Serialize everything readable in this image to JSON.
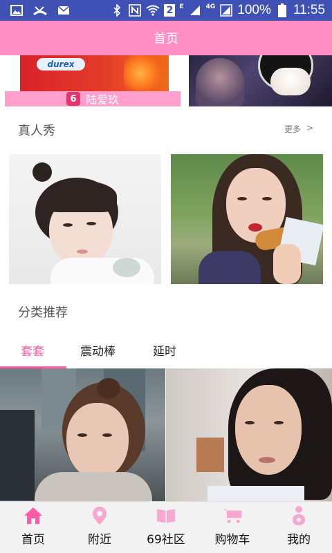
{
  "status_bar": {
    "network_badge": "2",
    "network_type_e": "E",
    "network_type_4g": "4G",
    "battery": "100%",
    "time": "11:55"
  },
  "app_bar": {
    "title": "首页"
  },
  "banner": {
    "durex_logo": "durex",
    "brand_mark": "6",
    "brand_name": "陆爱玖"
  },
  "sections": {
    "real_show": {
      "title": "真人秀",
      "more": "更多",
      "more_arrow": ">"
    },
    "category": {
      "title": "分类推荐"
    }
  },
  "tabs": [
    {
      "label": "套套",
      "active": true
    },
    {
      "label": "震动棒",
      "active": false
    },
    {
      "label": "延时",
      "active": false
    }
  ],
  "bottom_nav": [
    {
      "label": "首页",
      "icon": "home-icon",
      "active": true
    },
    {
      "label": "附近",
      "icon": "location-pin-icon",
      "active": false
    },
    {
      "label": "69社区",
      "icon": "book-icon",
      "active": false
    },
    {
      "label": "购物车",
      "icon": "cart-icon",
      "active": false
    },
    {
      "label": "我的",
      "icon": "user-icon",
      "active": false
    }
  ],
  "colors": {
    "status_bar": "#3f51b5",
    "app_bar": "#ff8ec5",
    "accent": "#ff5aa5",
    "nav_active": "#ff5aa5",
    "nav_icon": "#f7a8cf"
  }
}
